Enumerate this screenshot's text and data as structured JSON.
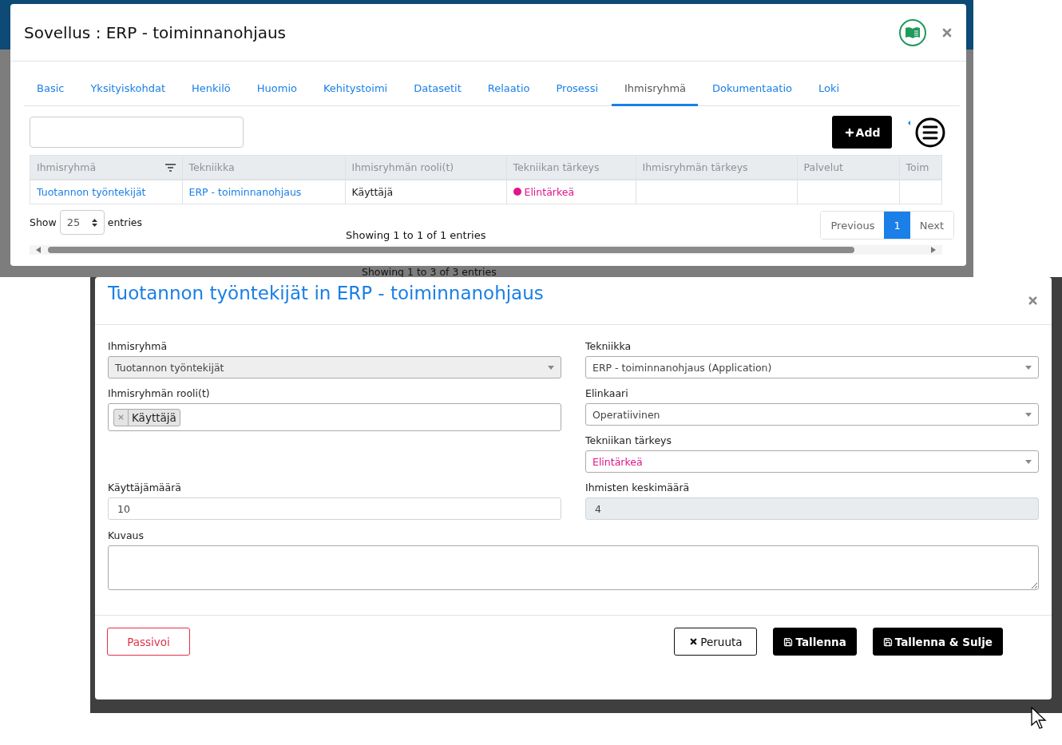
{
  "background": {
    "info": "Showing 1 to 3 of 3 entries"
  },
  "app_dialog": {
    "title": "Sovellus : ERP - toiminnanohjaus",
    "tabs": [
      {
        "label": "Basic",
        "selected": false
      },
      {
        "label": "Yksityiskohdat",
        "selected": false
      },
      {
        "label": "Henkilö",
        "selected": false
      },
      {
        "label": "Huomio",
        "selected": false
      },
      {
        "label": "Kehitystoimi",
        "selected": false
      },
      {
        "label": "Datasetit",
        "selected": false
      },
      {
        "label": "Relaatio",
        "selected": false
      },
      {
        "label": "Prosessi",
        "selected": false
      },
      {
        "label": "Ihmisryhmä",
        "selected": true
      },
      {
        "label": "Dokumentaatio",
        "selected": false
      },
      {
        "label": "Loki",
        "selected": false
      }
    ],
    "add_button": "Add",
    "table": {
      "columns": [
        {
          "label": "Ihmisryhmä",
          "filter": true
        },
        {
          "label": "Tekniikka",
          "filter": false
        },
        {
          "label": "Ihmisryhmän rooli(t)",
          "filter": false
        },
        {
          "label": "Tekniikan tärkeys",
          "filter": false
        },
        {
          "label": "Ihmisryhmän tärkeys",
          "filter": false
        },
        {
          "label": "Palvelut",
          "filter": false
        },
        {
          "label": "Toim",
          "filter": false
        }
      ],
      "rows": [
        {
          "cells": [
            {
              "kind": "link",
              "text": "Tuotannon työntekijät"
            },
            {
              "kind": "link",
              "text": "ERP - toiminnanohjaus"
            },
            {
              "kind": "text",
              "text": "Käyttäjä"
            },
            {
              "kind": "status",
              "text": "Elintärkeä",
              "color": "#e0168a"
            },
            {
              "kind": "empty"
            },
            {
              "kind": "empty"
            },
            {
              "kind": "empty"
            }
          ]
        }
      ]
    },
    "length_menu": {
      "before": "Show",
      "value": "25",
      "after": "entries"
    },
    "info": "Showing 1 to 1 of 1 entries",
    "pagination": {
      "previous": "Previous",
      "pages": [
        {
          "label": "1",
          "selected": true
        }
      ],
      "next": "Next"
    }
  },
  "edit_dialog": {
    "title": "Tuotannon työntekijät in ERP - toiminnanohjaus",
    "left_fields": [
      {
        "kind": "select",
        "label": "Ihmisryhmä",
        "value": "Tuotannon työntekijät",
        "disabled": true
      },
      {
        "kind": "tags",
        "label": "Ihmisryhmän rooli(t)",
        "tags": [
          "Käyttäjä"
        ]
      },
      {
        "kind": "input",
        "label": "Käyttäjämäärä",
        "value": "10",
        "disabled": false
      }
    ],
    "right_fields": [
      {
        "kind": "select",
        "label": "Tekniikka",
        "value": "ERP - toiminnanohjaus (Application)",
        "disabled": false
      },
      {
        "kind": "select",
        "label": "Elinkaari",
        "value": "Operatiivinen",
        "disabled": false
      },
      {
        "kind": "select",
        "label": "Tekniikan tärkeys",
        "value": "Elintärkeä",
        "disabled": false,
        "color": "#e0168a"
      },
      {
        "kind": "input",
        "label": "Ihmisten keskimäärä",
        "value": "4",
        "disabled": true
      }
    ],
    "description": {
      "label": "Kuvaus"
    },
    "buttons": [
      {
        "kind": "danger",
        "label": "Passivoi"
      },
      {
        "kind": "cancel",
        "label": "Peruuta"
      },
      {
        "kind": "save",
        "label": "Tallenna"
      },
      {
        "kind": "save",
        "label": "Tallenna & Sulje"
      }
    ]
  }
}
